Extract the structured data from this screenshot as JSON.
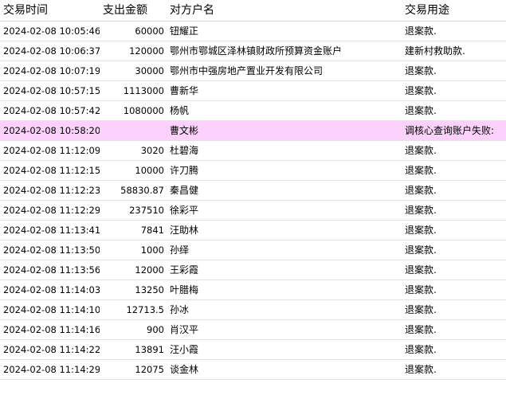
{
  "columns": {
    "time": "交易时间",
    "amount": "支出金额",
    "party": "对方户名",
    "use": "交易用途"
  },
  "rows": [
    {
      "time": "2024-02-08 10:05:46",
      "amount": "60000",
      "party": "钮耀正",
      "use": "退案款.",
      "highlight": false
    },
    {
      "time": "2024-02-08 10:06:37",
      "amount": "120000",
      "party": "鄂州市鄂城区泽林镇财政所预算资金账户",
      "use": "建新村救助款.",
      "highlight": false
    },
    {
      "time": "2024-02-08 10:07:19",
      "amount": "30000",
      "party": "鄂州市中强房地产置业开发有限公司",
      "use": "退案款.",
      "highlight": false
    },
    {
      "time": "2024-02-08 10:57:15",
      "amount": "1113000",
      "party": "曹新华",
      "use": "退案款.",
      "highlight": false
    },
    {
      "time": "2024-02-08 10:57:42",
      "amount": "1080000",
      "party": "杨帆",
      "use": "退案款.",
      "highlight": false
    },
    {
      "time": "2024-02-08 10:58:20",
      "amount": "",
      "party": "曹文彬",
      "use": "调核心查询账户失败:",
      "highlight": true
    },
    {
      "time": "2024-02-08 11:12:09",
      "amount": "3020",
      "party": "杜碧海",
      "use": "退案款.",
      "highlight": false
    },
    {
      "time": "2024-02-08 11:12:15",
      "amount": "10000",
      "party": "许刀腾",
      "use": "退案款.",
      "highlight": false
    },
    {
      "time": "2024-02-08 11:12:23",
      "amount": "58830.87",
      "party": "秦昌健",
      "use": "退案款.",
      "highlight": false
    },
    {
      "time": "2024-02-08 11:12:29",
      "amount": "237510",
      "party": "徐彩平",
      "use": "退案款.",
      "highlight": false
    },
    {
      "time": "2024-02-08 11:13:41",
      "amount": "7841",
      "party": "汪助林",
      "use": "退案款.",
      "highlight": false
    },
    {
      "time": "2024-02-08 11:13:50",
      "amount": "1000",
      "party": "孙绎",
      "use": "退案款.",
      "highlight": false
    },
    {
      "time": "2024-02-08 11:13:56",
      "amount": "12000",
      "party": "王彩霞",
      "use": "退案款.",
      "highlight": false
    },
    {
      "time": "2024-02-08 11:14:03",
      "amount": "13250",
      "party": "叶腊梅",
      "use": "退案款.",
      "highlight": false
    },
    {
      "time": "2024-02-08 11:14:10",
      "amount": "12713.5",
      "party": "孙冰",
      "use": "退案款.",
      "highlight": false
    },
    {
      "time": "2024-02-08 11:14:16",
      "amount": "900",
      "party": "肖汉平",
      "use": "退案款.",
      "highlight": false
    },
    {
      "time": "2024-02-08 11:14:22",
      "amount": "13891",
      "party": "汪小霞",
      "use": "退案款.",
      "highlight": false
    },
    {
      "time": "2024-02-08 11:14:29",
      "amount": "12075",
      "party": "谈金林",
      "use": "退案款.",
      "highlight": false
    }
  ],
  "colors": {
    "highlight_row": "#fcd2fc",
    "grid_line": "#e2e2e2"
  }
}
